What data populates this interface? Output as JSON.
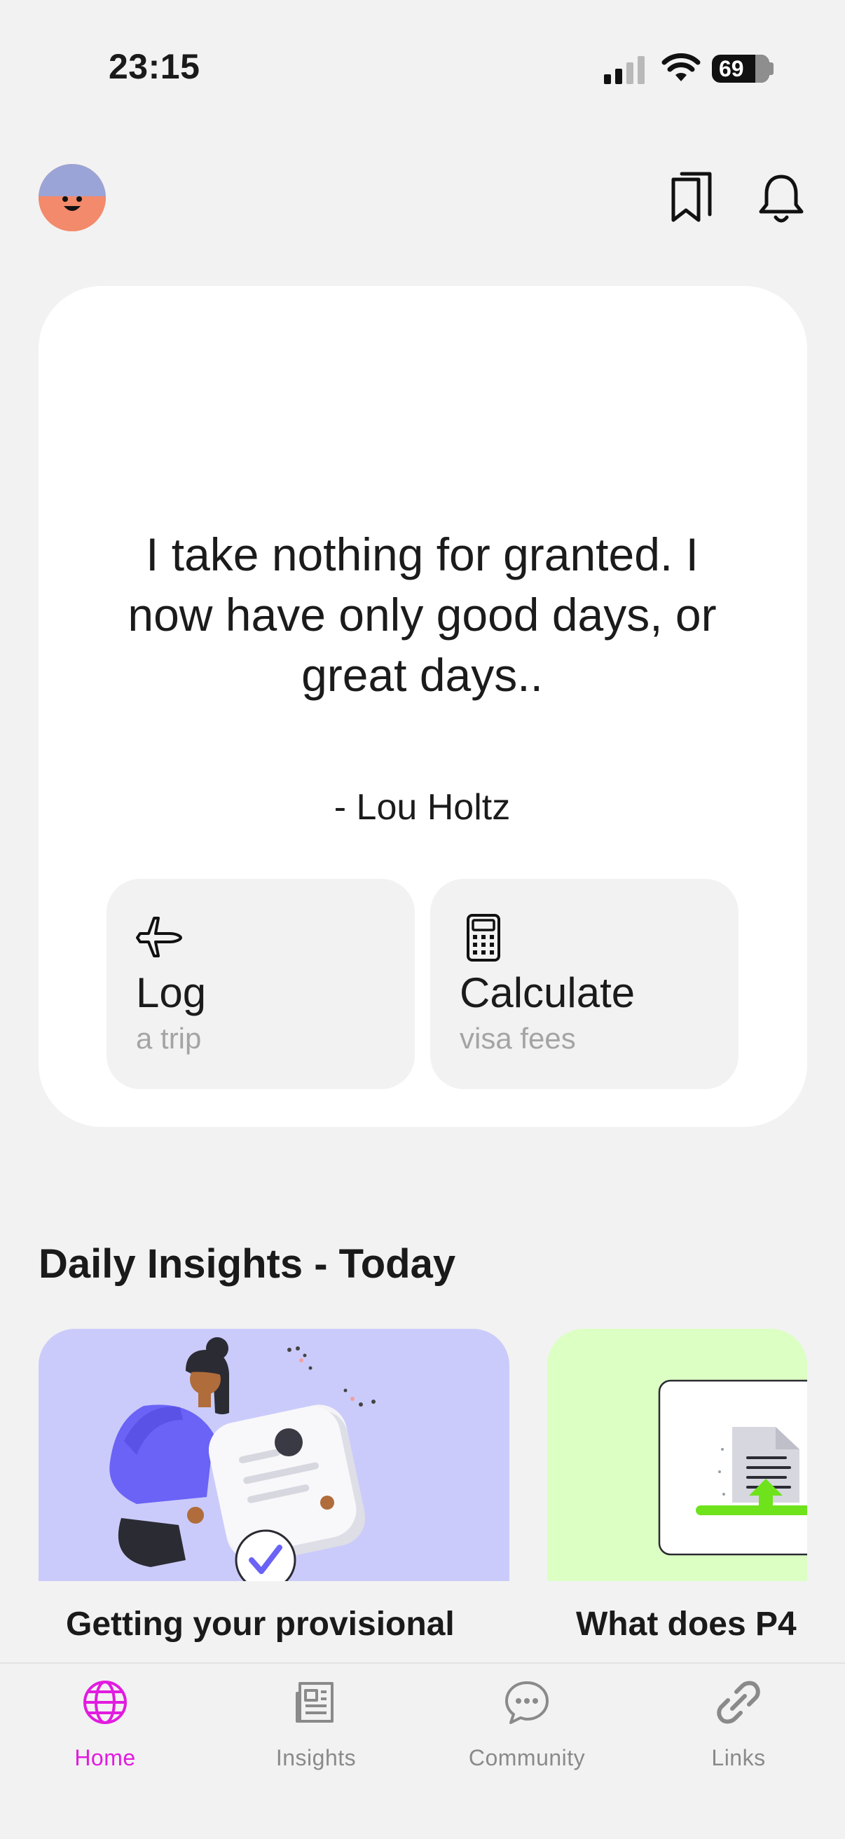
{
  "status_bar": {
    "time": "23:15",
    "battery": "69",
    "icons": [
      "cellular-signal-icon",
      "wifi-icon",
      "battery-icon"
    ]
  },
  "header": {
    "icons": [
      "avatar",
      "bookmarks-icon",
      "bell-icon"
    ]
  },
  "quote": {
    "text": "I take nothing for granted. I now have only good days, or great days..",
    "author": "- Lou Holtz"
  },
  "actions": [
    {
      "icon": "airplane-icon",
      "title": "Log",
      "subtitle": "a trip"
    },
    {
      "icon": "calculator-icon",
      "title": "Calculate",
      "subtitle": "visa fees"
    }
  ],
  "daily_insights": {
    "title": "Daily Insights - Today",
    "cards": [
      {
        "title": "Getting your provisional",
        "image": "woman-holding-approved-document-illustration",
        "bg": "#cbcbfb"
      },
      {
        "title": "What does P4",
        "image": "document-upload-illustration",
        "bg": "#dcffc3"
      }
    ]
  },
  "tabs": [
    {
      "label": "Home",
      "icon": "globe-icon",
      "active": true
    },
    {
      "label": "Insights",
      "icon": "newspaper-icon",
      "active": false
    },
    {
      "label": "Community",
      "icon": "chat-bubble-icon",
      "active": false
    },
    {
      "label": "Links",
      "icon": "link-icon",
      "active": false
    }
  ],
  "colors": {
    "background": "#f2f2f2",
    "card": "#ffffff",
    "accent": "#e21be0",
    "muted_text": "#a4a4a4"
  }
}
